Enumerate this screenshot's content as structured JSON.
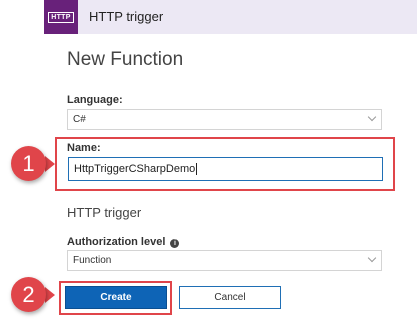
{
  "header": {
    "logo_text": "HTTP",
    "title": "HTTP trigger"
  },
  "form": {
    "heading": "New Function",
    "language_label": "Language:",
    "language_value": "C#",
    "name_label": "Name:",
    "name_value": "HttpTriggerCSharpDemo",
    "section_heading": "HTTP trigger",
    "auth_label": "Authorization level",
    "auth_value": "Function"
  },
  "buttons": {
    "create_label": "Create",
    "cancel_label": "Cancel"
  },
  "callouts": {
    "step1": "1",
    "step2": "2",
    "highlight_color": "#e0454a"
  },
  "colors": {
    "brand": "#68217a",
    "header_bg": "#ece8f4",
    "primary_button": "#0e64b6",
    "input_focus": "#1f6fb5"
  },
  "icons": {
    "info": "info-icon",
    "dropdown": "chevron-down-icon"
  }
}
